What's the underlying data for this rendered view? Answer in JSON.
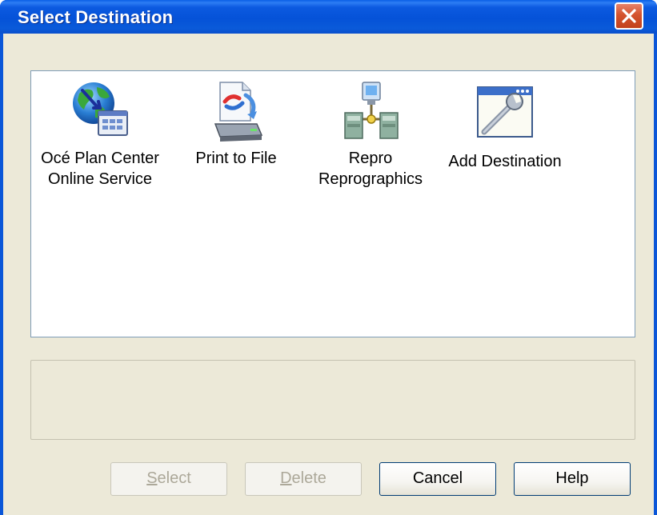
{
  "window": {
    "title": "Select Destination"
  },
  "destinations": [
    {
      "line1": "Océ Plan Center",
      "line2": "Online Service",
      "icon": "globe-monitor-icon"
    },
    {
      "line1": "Print to File",
      "line2": "",
      "icon": "print-to-file-icon"
    },
    {
      "line1": "Repro",
      "line2": "Reprographics",
      "icon": "network-printers-icon"
    },
    {
      "line1": "Add Destination",
      "line2": "",
      "icon": "add-window-wrench-icon"
    }
  ],
  "buttons": {
    "select": {
      "accel": "S",
      "rest": "elect"
    },
    "delete": {
      "accel": "D",
      "rest": "elete"
    },
    "cancel": "Cancel",
    "help": "Help"
  },
  "colors": {
    "titlebar": "#0a56d8",
    "dialog_bg": "#ece9d8",
    "close_button": "#d4532e"
  }
}
